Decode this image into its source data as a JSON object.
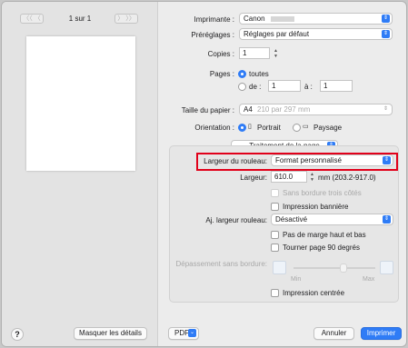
{
  "preview": {
    "prev_label": "〈〈  〈",
    "next_label": "〉 〉〉",
    "page_count": "1 sur 1",
    "help_label": "?",
    "hide_details_label": "Masquer les détails"
  },
  "form": {
    "printer_label": "Imprimante :",
    "printer_value": "Canon",
    "presets_label": "Préréglages :",
    "presets_value": "Réglages par défaut",
    "copies_label": "Copies :",
    "copies_value": "1",
    "pages_label": "Pages :",
    "pages_all": "toutes",
    "pages_from": "de :",
    "pages_from_value": "1",
    "pages_to": "à :",
    "pages_to_value": "1",
    "paper_size_label": "Taille du papier :",
    "paper_size_value": "A4",
    "paper_size_dims": "210 par 297 mm",
    "orientation_label": "Orientation :",
    "orientation_portrait": "Portrait",
    "orientation_landscape": "Paysage",
    "section_value": "Traitement de la page"
  },
  "panel": {
    "roll_width_label": "Largeur du rouleau:",
    "roll_width_value": "Format personnalisé",
    "width_label": "Largeur:",
    "width_value": "610.0",
    "width_unit": "mm (203.2-917.0)",
    "borderless_three": "Sans bordure trois côtés",
    "banner": "Impression bannière",
    "adjust_label": "Aj. largeur rouleau:",
    "adjust_value": "Désactivé",
    "no_margin": "Pas de marge haut et bas",
    "rotate": "Tourner page 90 degrés",
    "overflow_label": "Dépassement sans bordure:",
    "slider_min": "Min",
    "slider_max": "Max",
    "centered": "Impression centrée"
  },
  "footer": {
    "pdf_label": "PDF",
    "cancel_label": "Annuler",
    "print_label": "Imprimer"
  },
  "colors": {
    "accent": "#2f7cf6",
    "highlight": "#e1001a"
  }
}
